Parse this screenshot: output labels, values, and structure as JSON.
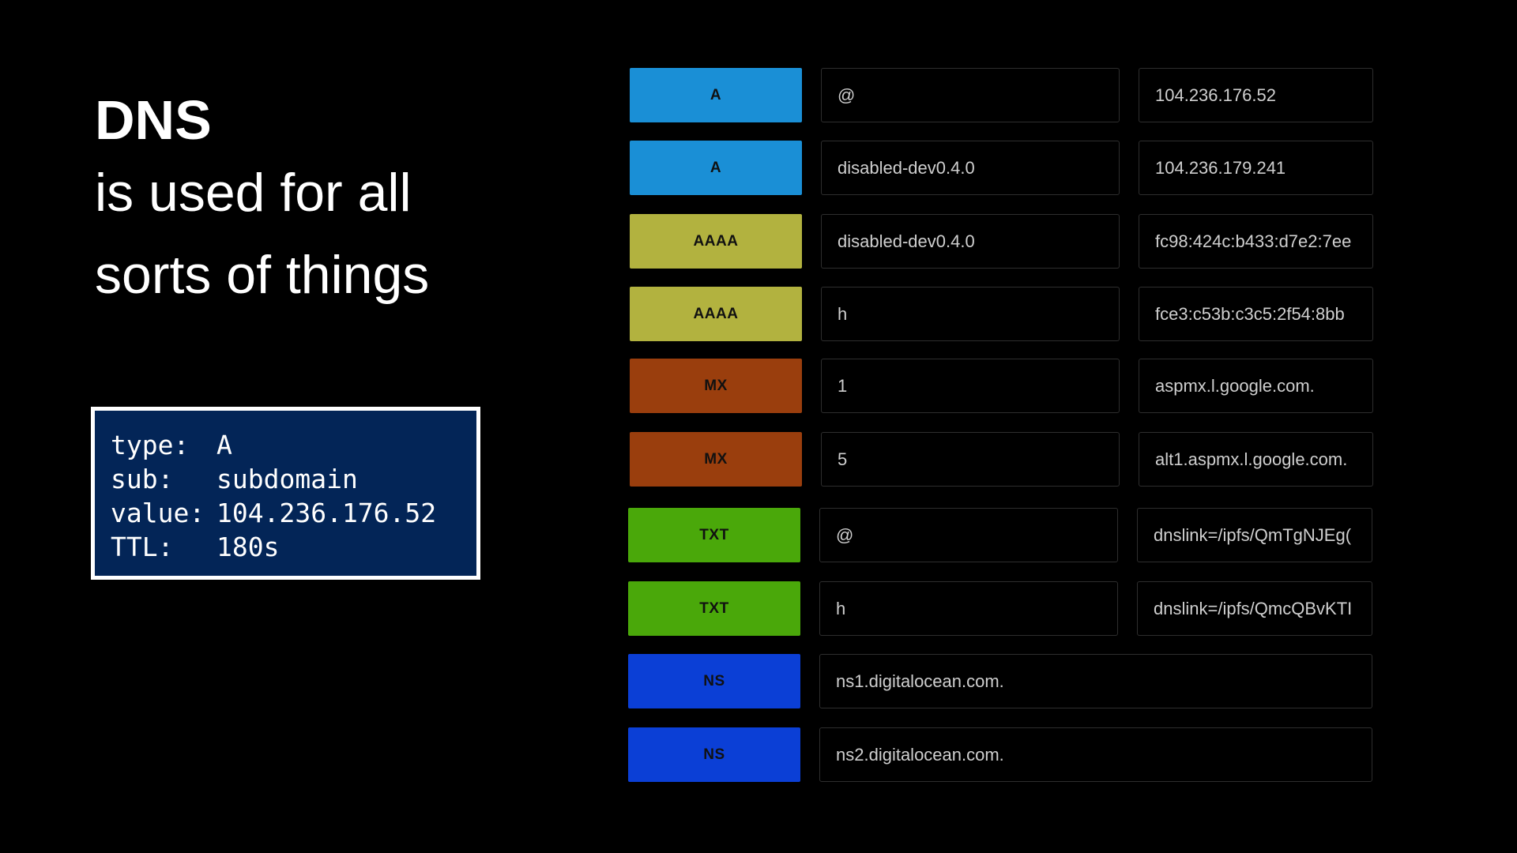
{
  "headline": {
    "title": "DNS",
    "subtitle_lines": [
      "is used for all",
      "sorts of things"
    ]
  },
  "record_example": {
    "lines": [
      {
        "key": "type:",
        "value": "A"
      },
      {
        "key": "sub:",
        "value": "subdomain"
      },
      {
        "key": "value:",
        "value": "104.236.176.52"
      },
      {
        "key": "TTL:",
        "value": "180s"
      }
    ]
  },
  "records": [
    {
      "type": "A",
      "color": "#1a8fd6",
      "host": "@",
      "value": "104.236.176.52"
    },
    {
      "type": "A",
      "color": "#1a8fd6",
      "host": "disabled-dev0.4.0",
      "value": "104.236.179.241"
    },
    {
      "type": "AAAA",
      "color": "#b2b23f",
      "host": "disabled-dev0.4.0",
      "value": "fc98:424c:b433:d7e2:7ee"
    },
    {
      "type": "AAAA",
      "color": "#b2b23f",
      "host": "h",
      "value": "fce3:c53b:c3c5:2f54:8bb"
    },
    {
      "type": "MX",
      "color": "#9a3e0d",
      "host": "1",
      "value": "aspmx.l.google.com."
    },
    {
      "type": "MX",
      "color": "#9a3e0d",
      "host": "5",
      "value": "alt1.aspmx.l.google.com."
    },
    {
      "type": "TXT",
      "color": "#4aa80a",
      "host": "@",
      "value": "dnslink=/ipfs/QmTgNJEg("
    },
    {
      "type": "TXT",
      "color": "#4aa80a",
      "host": "h",
      "value": "dnslink=/ipfs/QmcQBvKTI"
    },
    {
      "type": "NS",
      "color": "#0b3fd6",
      "host": "ns1.digitalocean.com."
    },
    {
      "type": "NS",
      "color": "#0b3fd6",
      "host": "ns2.digitalocean.com."
    }
  ]
}
